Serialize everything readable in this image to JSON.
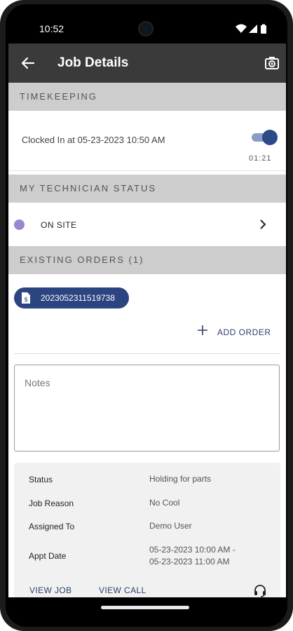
{
  "statusbar": {
    "time": "10:52",
    "icons": [
      "wifi-icon",
      "signal-icon",
      "battery-icon"
    ]
  },
  "appbar": {
    "title": "Job Details",
    "back_icon": "arrow-left-icon",
    "action_icon": "camera-icon"
  },
  "timekeeping": {
    "header": "TIMEKEEPING",
    "clocked_text": "Clocked In at 05-23-2023 10:50 AM",
    "clocked_in": true,
    "elapsed": "01:21"
  },
  "technician_status": {
    "header": "MY TECHNICIAN STATUS",
    "status": "ON SITE",
    "dot_color": "#9b86d0"
  },
  "existing_orders": {
    "header": "EXISTING ORDERS (1)",
    "orders": [
      "2023052311519738"
    ],
    "add_order_label": "ADD ORDER"
  },
  "notes": {
    "placeholder": "Notes",
    "value": ""
  },
  "details": {
    "rows": [
      {
        "label": "Status",
        "value": "Holding for parts"
      },
      {
        "label": "Job Reason",
        "value": "No Cool"
      },
      {
        "label": "Assigned To",
        "value": "Demo User"
      },
      {
        "label": "Appt Date",
        "value_line1": "05-23-2023 10:00 AM -",
        "value_line2": "05-23-2023 11:00 AM"
      }
    ],
    "view_job_label": "VIEW JOB",
    "view_call_label": "VIEW CALL",
    "support_icon": "headset-icon"
  },
  "colors": {
    "appbar": "#3a3a3a",
    "accent": "#2c4580",
    "section_header": "#cdcdcd"
  }
}
